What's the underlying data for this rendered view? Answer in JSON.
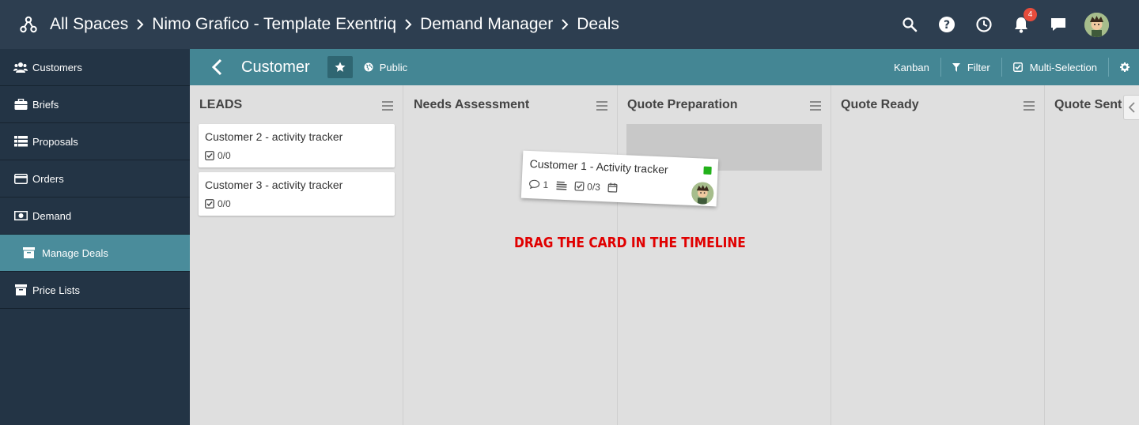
{
  "topbar": {
    "breadcrumbs": [
      "All Spaces",
      "Nimo Grafico - Template Exentriq",
      "Demand Manager",
      "Deals"
    ],
    "notifications_count": "4"
  },
  "sidebar": {
    "items": [
      {
        "label": "Customers",
        "icon": "users-icon"
      },
      {
        "label": "Briefs",
        "icon": "briefcase-icon"
      },
      {
        "label": "Proposals",
        "icon": "list-icon"
      },
      {
        "label": "Orders",
        "icon": "credit-card-icon"
      },
      {
        "label": "Demand",
        "icon": "money-icon"
      },
      {
        "label": "Manage Deals",
        "icon": "archive-icon",
        "active": true
      },
      {
        "label": "Price Lists",
        "icon": "archive-icon"
      }
    ]
  },
  "subbar": {
    "title": "Customer",
    "visibility": "Public",
    "view": "Kanban",
    "filter": "Filter",
    "multi": "Multi-Selection"
  },
  "board": {
    "columns": [
      {
        "title": "LEADS",
        "cards": [
          {
            "title": "Customer 2 - activity tracker",
            "checklist": "0/0"
          },
          {
            "title": "Customer 3 - activity tracker",
            "checklist": "0/0"
          }
        ]
      },
      {
        "title": "Needs Assessment",
        "cards": []
      },
      {
        "title": "Quote Preparation",
        "cards": []
      },
      {
        "title": "Quote Ready",
        "cards": []
      },
      {
        "title": "Quote Sent",
        "cards": []
      }
    ],
    "dragging_card": {
      "title": "Customer 1 - Activity tracker",
      "comments": "1",
      "checklist": "0/3",
      "label_color": "#22b11a"
    },
    "instruction": "DRAG THE CARD IN THE TIMELINE"
  },
  "colors": {
    "topbar": "#2d3e50",
    "sidebar": "#233445",
    "subbar": "#448694",
    "active_item": "#4a8c9b",
    "instruction": "#e00000"
  }
}
